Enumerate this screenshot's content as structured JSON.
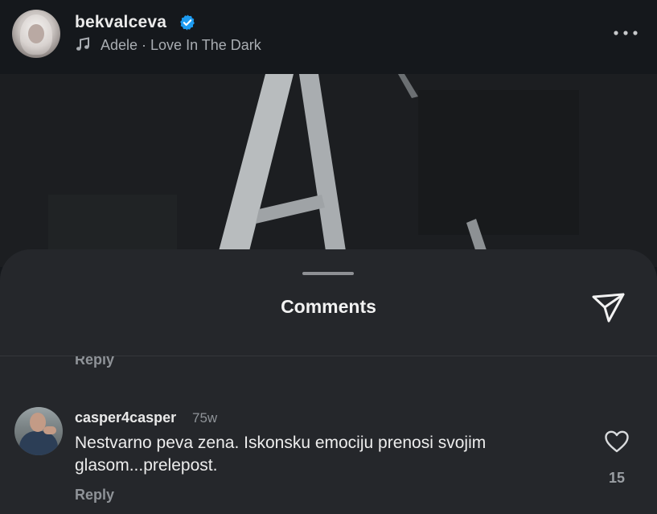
{
  "post": {
    "username": "bekvalceva",
    "music": "Adele · Love In The Dark"
  },
  "sheet": {
    "title": "Comments",
    "previous_reply_label": "Reply"
  },
  "comments": [
    {
      "username": "casper4casper",
      "time": "75w",
      "text": "Nestvarno peva zena. Iskonsku emociju prenosi svojim glasom...prelepost.",
      "reply_label": "Reply",
      "likes": "15"
    }
  ],
  "icons": {
    "verified": "verified-badge-icon",
    "music": "music-note-icon",
    "more": "more-options-icon",
    "share": "send-icon",
    "like": "heart-icon"
  },
  "colors": {
    "background": "#15181c",
    "sheet": "#25272b",
    "verified": "#1d9bf0",
    "muted_text": "#8f9398"
  }
}
